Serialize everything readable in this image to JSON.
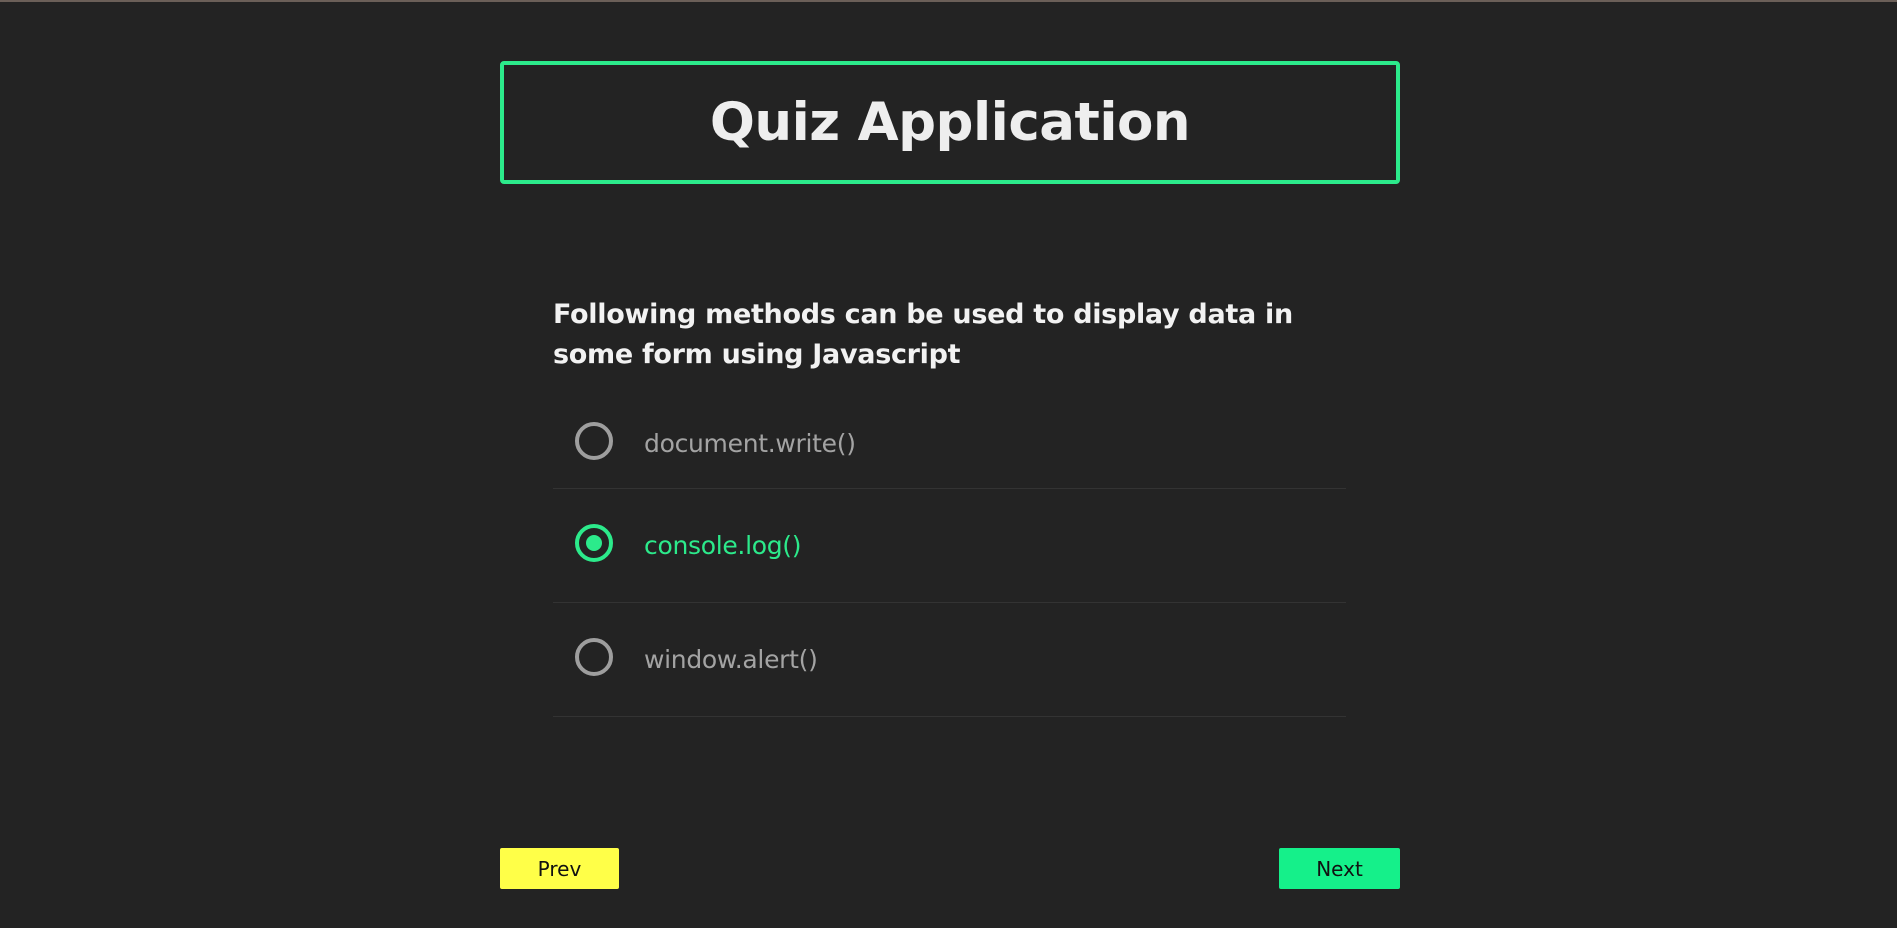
{
  "header": {
    "title": "Quiz Application"
  },
  "question": {
    "text": "Following methods can be used to display data in some form using Javascript",
    "options": [
      {
        "label": "document.write()",
        "selected": false
      },
      {
        "label": "console.log()",
        "selected": true
      },
      {
        "label": "window.alert()",
        "selected": false
      }
    ]
  },
  "navigation": {
    "prev_label": "Prev",
    "next_label": "Next"
  },
  "colors": {
    "background": "#232323",
    "accent": "#2cea8b",
    "prev_button": "#ffff48",
    "next_button": "#15f08a"
  }
}
